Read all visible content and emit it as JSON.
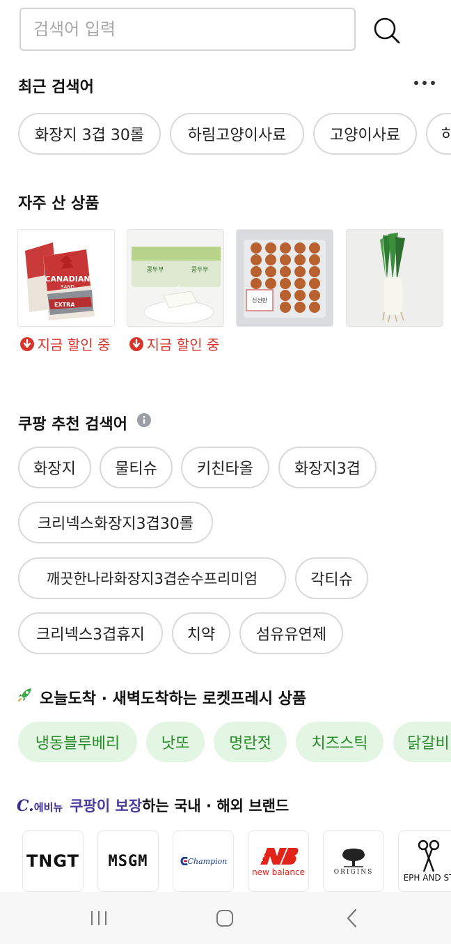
{
  "search": {
    "placeholder": "검색어 입력",
    "value": ""
  },
  "recent": {
    "title": "최근 검색어",
    "chips": [
      "화장지 3겹 30롤",
      "하림고양이사료",
      "고양이사료",
      "하"
    ]
  },
  "frequent": {
    "title": "자주 산 상품",
    "products": [
      {
        "image": "canadian-sand-cat-litter",
        "brand_text": "CANADIAN",
        "brand_text2": "SAND",
        "variant_text": "EXTRA",
        "badge": "지금 할인 중"
      },
      {
        "image": "tofu-pack",
        "pack_text": "콩두부",
        "badge": "지금 할인 중"
      },
      {
        "image": "egg-tray",
        "pack_text": "신선란",
        "badge": ""
      },
      {
        "image": "green-onion",
        "badge": ""
      }
    ]
  },
  "recommended": {
    "title": "쿠팡 추천 검색어",
    "chips": [
      "화장지",
      "물티슈",
      "키친타올",
      "화장지3겹",
      "크리넥스화장지3겹30롤",
      "깨끗한나라화장지3겹순수프리미엄",
      "각티슈",
      "크리넥스3겹휴지",
      "치약",
      "섬유유연제"
    ]
  },
  "fresh": {
    "title": "오늘도착 · 새벽도착하는 로켓프레시 상품",
    "chips": [
      "냉동블루베리",
      "낫또",
      "명란젓",
      "치즈스틱",
      "닭갈비"
    ]
  },
  "brands": {
    "logo_text": "C.",
    "logo_sub": "에비뉴",
    "highlight": "쿠팡이 보장",
    "rest": "하는 국내 · 해외 브랜드",
    "items": [
      {
        "name": "TNGT"
      },
      {
        "name": "MSGM"
      },
      {
        "name": "Champion"
      },
      {
        "name": "new balance"
      },
      {
        "name": "ORIGINS"
      },
      {
        "name": "EPH AND ST"
      }
    ]
  },
  "colors": {
    "discount": "#d9342b",
    "fresh_chip_bg": "#e3f6e3",
    "fresh_chip_text": "#2a8b2a",
    "brand_accent": "#4a3ba0"
  }
}
